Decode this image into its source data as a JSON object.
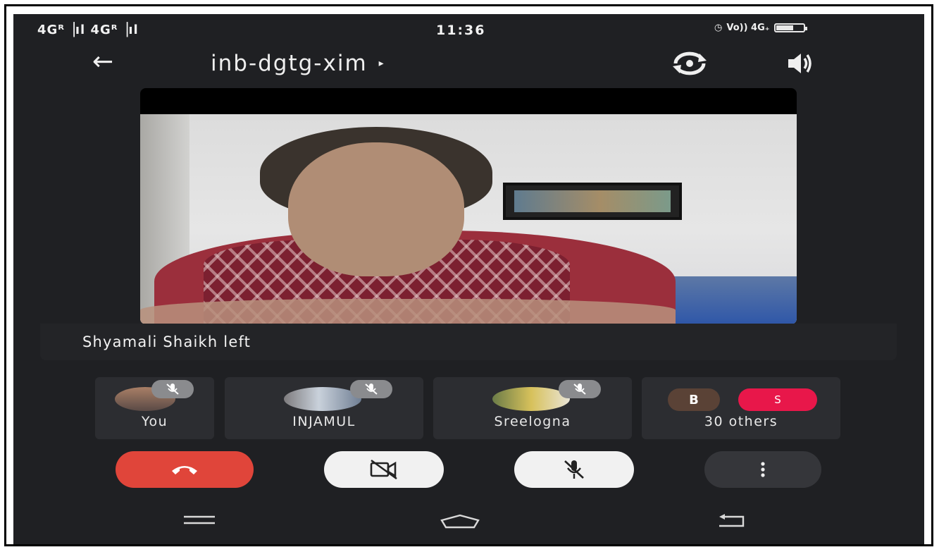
{
  "status_bar": {
    "network": "4Gᴿ▕ıl 4Gᴿ▕ıl",
    "time": "11:36",
    "right_indicators": "Vo)) 4G₊",
    "battery_level": 0.6
  },
  "header": {
    "meeting_code": "inb-dgtg-xim",
    "title_caret": "▸"
  },
  "notification": {
    "text": "Shyamali Shaikh left"
  },
  "participants": [
    {
      "label": "You",
      "muted": true
    },
    {
      "label": "INJAMUL",
      "muted": true
    },
    {
      "label": "Sreelogna",
      "muted": true
    },
    {
      "label": "30 others",
      "avatars": [
        "B",
        "S"
      ]
    }
  ],
  "colors": {
    "background": "#1f2023",
    "end_call": "#e0453a",
    "avatar_b": "#5a4236",
    "avatar_s": "#e8174a"
  },
  "icons": {
    "back": "arrow-left-icon",
    "camera_switch": "camera-switch-icon",
    "speaker": "speaker-icon",
    "end_call": "phone-hangup-icon",
    "camera_off": "camera-off-icon",
    "mic_off": "mic-off-icon",
    "more": "more-vertical-icon"
  }
}
